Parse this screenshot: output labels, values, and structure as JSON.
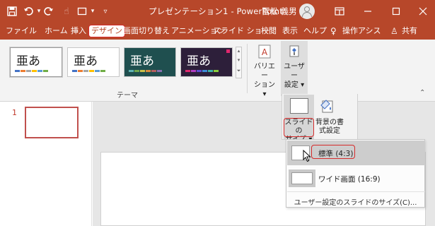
{
  "titlebar": {
    "document_title": "プレゼンテーション1 - PowerPoint",
    "user_name": "冨松 義男",
    "icons": [
      "save-icon",
      "undo-icon",
      "redo-icon",
      "touch-mode-icon",
      "new-slide-icon",
      "customize-qat-icon",
      "ribbon-display-icon",
      "minimize-icon",
      "maximize-icon",
      "close-icon"
    ]
  },
  "tabs": [
    "ファイル",
    "ホーム",
    "挿入",
    "デザイン",
    "画面切り替え",
    "アニメーション",
    "スライド ショー",
    "校閲",
    "表示",
    "ヘルプ"
  ],
  "active_tab": "デザイン",
  "tell_me": "操作アシス",
  "share": "共有",
  "ribbon": {
    "themes_group_label": "テーマ",
    "theme_glyph": "亜あ",
    "variations_label_line1": "バリエー",
    "variations_label_line2": "ション ▾",
    "user_settings_line1": "ユーザー",
    "user_settings_line2": "設定 ▾",
    "slide_size_line1": "スライドの",
    "slide_size_line2": "サイズ ▾",
    "bg_format_line1": "背景の書",
    "bg_format_line2": "式設定"
  },
  "slides_panel": {
    "slide_number": "1"
  },
  "slide_size_menu": {
    "standard": "標準 (4:3)",
    "widescreen": "ワイド画面 (16:9)",
    "custom": "ユーザー設定のスライドのサイズ(C)..."
  },
  "colors": {
    "accent": "#b7472a",
    "highlight_red": "#d62b2b",
    "ribbon_bg": "#f3f3f3"
  }
}
